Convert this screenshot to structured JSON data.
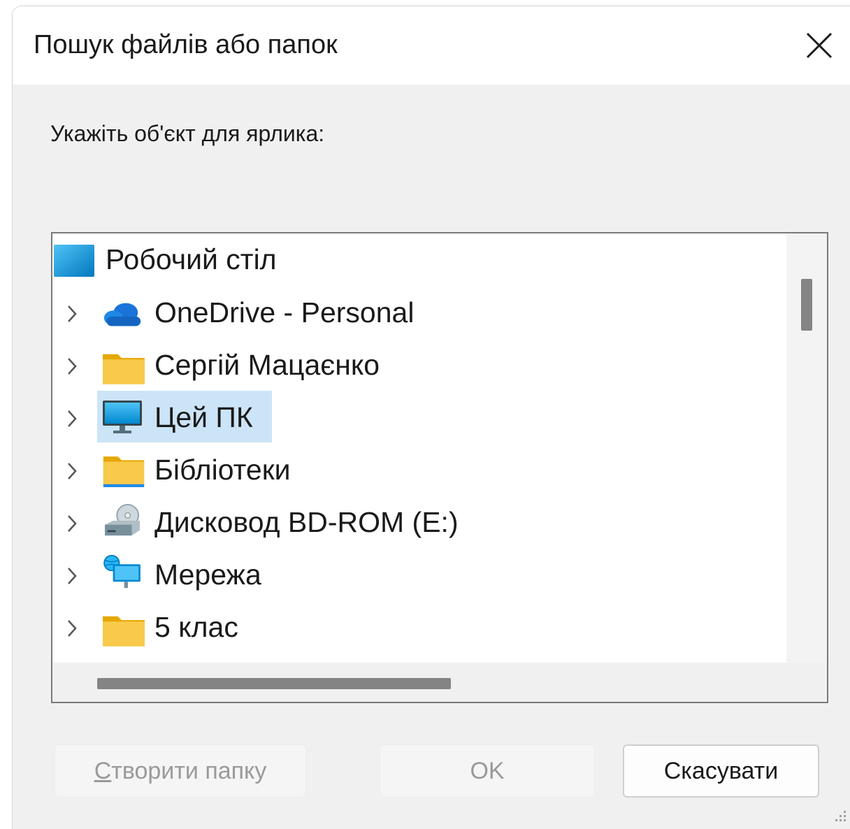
{
  "dialog": {
    "title": "Пошук файлів або папок",
    "prompt": "Укажіть об'єкт для ярлика:"
  },
  "tree": {
    "root": {
      "label": "Робочий стіл",
      "icon": "desktop-icon"
    },
    "items": [
      {
        "label": "OneDrive - Personal",
        "icon": "onedrive-cloud-icon"
      },
      {
        "label": "Сергій Мацаєнко",
        "icon": "folder-icon"
      },
      {
        "label": "Цей ПК",
        "icon": "monitor-icon",
        "selected": true
      },
      {
        "label": "Бібліотеки",
        "icon": "library-folder-icon"
      },
      {
        "label": "Дисковод BD-ROM (E:)",
        "icon": "optical-drive-icon"
      },
      {
        "label": "Мережа",
        "icon": "network-icon"
      },
      {
        "label": "5 клас",
        "icon": "folder-icon"
      }
    ]
  },
  "buttons": {
    "new_folder_prefix": "С",
    "new_folder_rest": "творити папку",
    "ok": "OK",
    "cancel": "Скасувати"
  },
  "colors": {
    "selection": "#cce4f7",
    "folder": "#f8c94b",
    "dialog_bg": "#f0f0f0"
  }
}
